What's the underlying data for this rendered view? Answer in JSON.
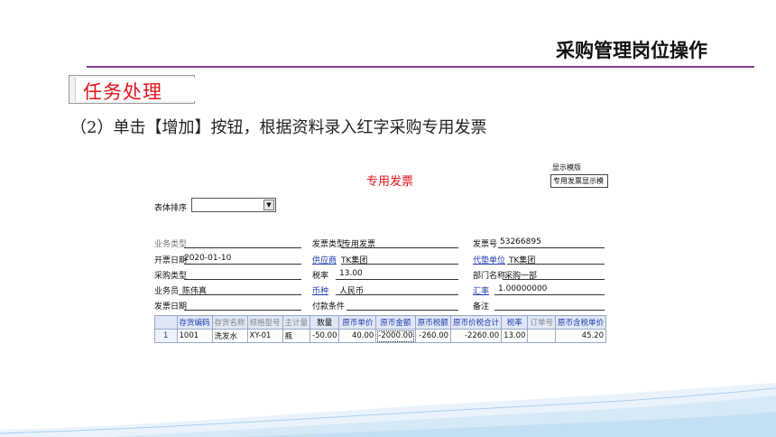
{
  "slide": {
    "title": "采购管理岗位操作",
    "task_label": "任务处理",
    "instruction": "（2）单击【增加】按钮，根据资料录入红字采购专用发票"
  },
  "app": {
    "doc_title": "专用发票",
    "display_template_label": "显示模版",
    "display_template_value": "专用发票显示模",
    "sort_label": "表体排序",
    "sort_value": "",
    "fields": {
      "biz_type_label": "业务类型",
      "biz_type_value": "",
      "invoice_type_label": "发票类型",
      "invoice_type_value": "专用发票",
      "invoice_no_label": "发票号",
      "invoice_no_value": "53266895",
      "issue_date_label": "开票日期",
      "issue_date_value": "2020-01-10",
      "supplier_label": "供应商",
      "supplier_value": "TK集团",
      "agent_label": "代垫单位",
      "agent_value": "TK集团",
      "purchase_type_label": "采购类型",
      "purchase_type_value": "",
      "tax_rate_label": "税率",
      "tax_rate_value": "13.00",
      "dept_label": "部门名称",
      "dept_value": "采购一部",
      "clerk_label": "业务员",
      "clerk_value": "陈伟真",
      "currency_label": "币种",
      "currency_value": "人民币",
      "exchange_rate_label": "汇率",
      "exchange_rate_value": "1.00000000",
      "ship_date_label": "发票日期",
      "ship_date_value": "",
      "payment_label": "付款条件",
      "payment_value": "",
      "remark_label": "备注",
      "remark_value": ""
    },
    "grid": {
      "headers": [
        "",
        "存货编码",
        "存货名称",
        "规格型号",
        "主计量",
        "数量",
        "原币单价",
        "原币金额",
        "原币税额",
        "原币价税合计",
        "税率",
        "订单号",
        "原币含税单价"
      ],
      "rows": [
        [
          "1",
          "1001",
          "洗发水",
          "XY-01",
          "瓶",
          "-50.00",
          "40.00",
          "-2000.00",
          "-260.00",
          "-2260.00",
          "13.00",
          "",
          "45.20"
        ]
      ]
    }
  },
  "colors": {
    "accent_red": "#e3141b",
    "rule_purple": "#7b3f8f",
    "link_blue": "#1f3fae"
  }
}
